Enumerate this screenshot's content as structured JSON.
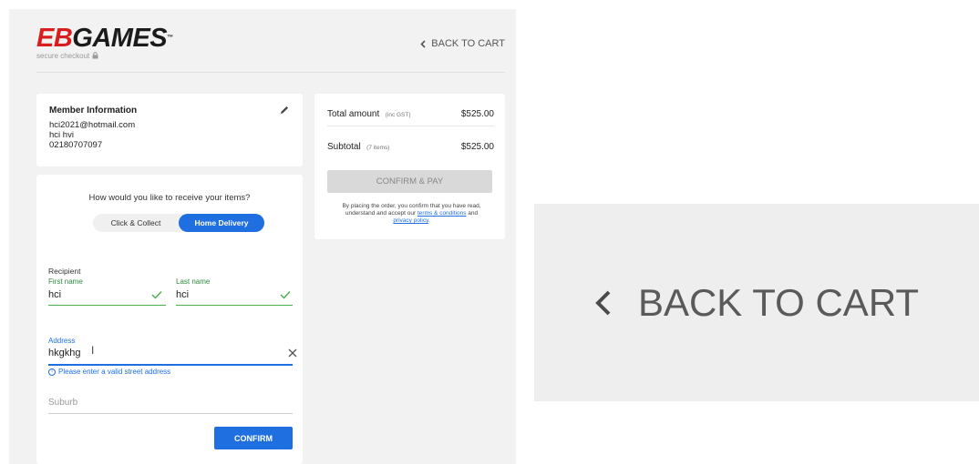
{
  "header": {
    "logo_eb": "EB",
    "logo_games": "GAMES",
    "logo_tm": "™",
    "secure_text": "secure checkout",
    "back_link": "BACK TO CART"
  },
  "member": {
    "title": "Member Information",
    "email": "hci2021@hotmail.com",
    "name": "hci hvi",
    "phone": "02180707097"
  },
  "delivery": {
    "question": "How would you like to receive your items?",
    "options": [
      "Click & Collect",
      "Home Delivery"
    ],
    "selected": "Home Delivery",
    "recipient_label": "Recipient",
    "first_name_label": "First name",
    "first_name_value": "hci",
    "last_name_label": "Last name",
    "last_name_value": "hci",
    "address_label": "Address",
    "address_value": "hkgkhg",
    "address_error": "Please enter a valid street address",
    "suburb_placeholder": "Suburb",
    "confirm_label": "CONFIRM"
  },
  "summary": {
    "total_label": "Total amount",
    "total_note": "(inc GST)",
    "total_value": "$525.00",
    "subtotal_label": "Subtotal",
    "subtotal_note": "(7 items)",
    "subtotal_value": "$525.00",
    "pay_label": "CONFIRM & PAY",
    "legal_prefix": "By placing the order, you confirm that you have read, understand and accept our",
    "terms_link": "terms & conditions",
    "legal_and": "and",
    "privacy_link": "privacy policy",
    "legal_suffix": "."
  },
  "zoom": {
    "back_link": "BACK TO CART"
  },
  "colors": {
    "brand_red": "#d81e1e",
    "primary_blue": "#1f6fe0",
    "valid_green": "#4caf50"
  }
}
